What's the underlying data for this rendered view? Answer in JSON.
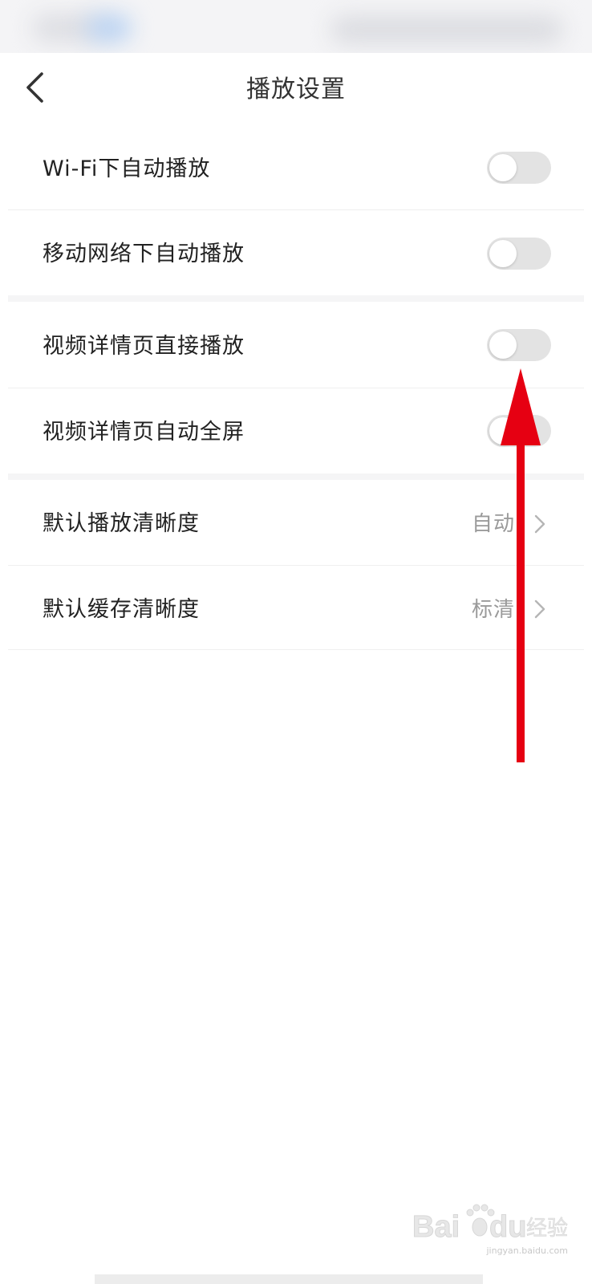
{
  "header": {
    "title": "播放设置",
    "back_icon": "chevron-left-icon"
  },
  "settings": {
    "wifi_autoplay": {
      "label": "Wi-Fi下自动播放",
      "enabled": false
    },
    "mobile_autoplay": {
      "label": "移动网络下自动播放",
      "enabled": false
    },
    "detail_direct_play": {
      "label": "视频详情页直接播放",
      "enabled": false
    },
    "detail_auto_fullscreen": {
      "label": "视频详情页自动全屏",
      "enabled": false
    },
    "default_play_quality": {
      "label": "默认播放清晰度",
      "value": "自动"
    },
    "default_cache_quality": {
      "label": "默认缓存清晰度",
      "value": "标清"
    }
  },
  "annotation": {
    "arrow_color": "#e60012",
    "points_to": "detail_direct_play toggle"
  },
  "watermark": {
    "brand": "Baidu经验",
    "domain": "jingyan.baidu.com"
  },
  "colors": {
    "toggle_off": "#e3e3e3",
    "value_text": "#9a9a9a",
    "arrow": "#e60012"
  }
}
